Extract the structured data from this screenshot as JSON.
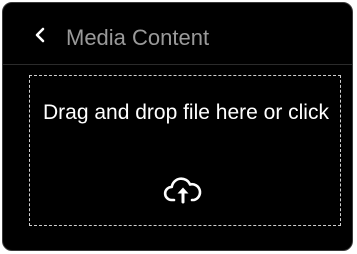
{
  "header": {
    "title": "Media Content",
    "back_icon": "chevron-left-icon"
  },
  "dropzone": {
    "text": "Drag and drop file here or click",
    "icon": "cloud-upload-icon"
  },
  "colors": {
    "panel_background": "#000000",
    "title_text": "#9a9a9a",
    "primary_text": "#ffffff",
    "dashed_border": "#cfcfcf"
  }
}
